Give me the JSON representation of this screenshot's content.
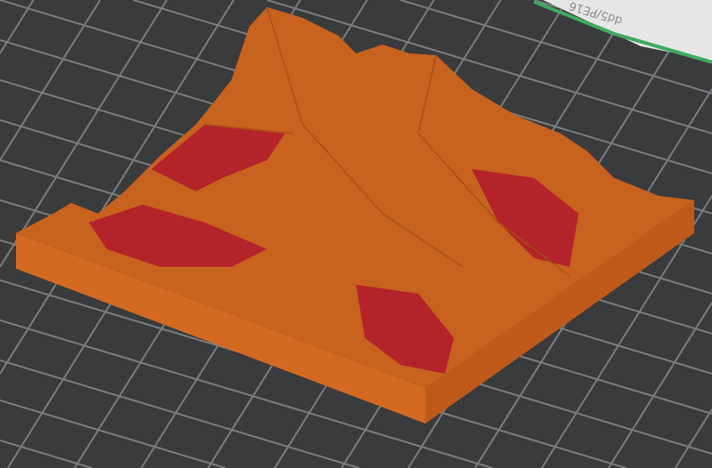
{
  "viewport": {
    "bed_label": "dd5/PE16",
    "colors": {
      "background": "#3a3b3c",
      "grid_line": "#7b7d7f",
      "bed_sheet": "#e6e6e6",
      "bed_edge": "#3faa5c",
      "model_main": "#c8621f",
      "model_side": "#d46a22",
      "model_overhang": "#b4242a"
    }
  }
}
